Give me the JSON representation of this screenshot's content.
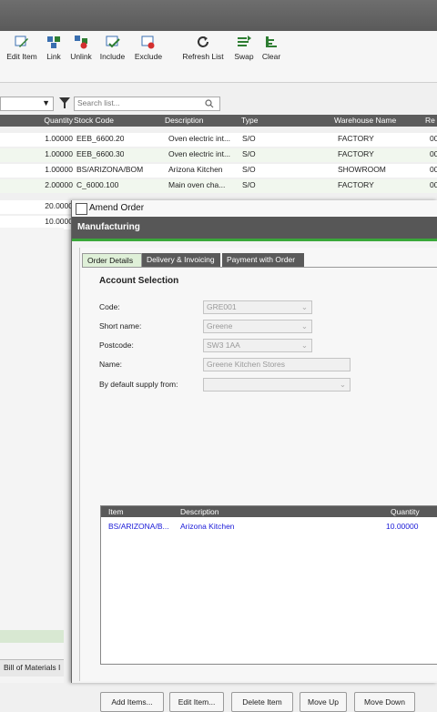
{
  "ribbon": {
    "buttons": [
      {
        "label": "Edit Item",
        "icon": "edit-item-icon"
      },
      {
        "label": "Link",
        "icon": "link-icon"
      },
      {
        "label": "Unlink",
        "icon": "unlink-icon"
      },
      {
        "label": "Include",
        "icon": "include-icon"
      },
      {
        "label": "Exclude",
        "icon": "exclude-icon"
      },
      {
        "label": "Refresh List",
        "icon": "refresh-icon"
      },
      {
        "label": "Swap",
        "icon": "swap-icon"
      },
      {
        "label": "Clear",
        "icon": "clear-icon"
      }
    ]
  },
  "search": {
    "placeholder": "Search list..."
  },
  "grid": {
    "columns": [
      "Quantity",
      "Stock Code",
      "Description",
      "Type",
      "Warehouse Name",
      "Re"
    ],
    "rows": [
      [
        "1.00000",
        "EEB_6600.20",
        "Oven electric int...",
        "S/O",
        "FACTORY",
        "00"
      ],
      [
        "1.00000",
        "EEB_6600.30",
        "Oven electric int...",
        "S/O",
        "FACTORY",
        "00"
      ],
      [
        "1.00000",
        "BS/ARIZONA/BOM",
        "Arizona Kitchen",
        "S/O",
        "SHOWROOM",
        "00"
      ],
      [
        "2.00000",
        "C_6000.100",
        "Main oven cha...",
        "S/O",
        "FACTORY",
        "00"
      ],
      [
        "20.0000",
        "",
        "",
        "",
        "",
        ""
      ],
      [
        "10.0000",
        "",
        "",
        "",
        "",
        ""
      ]
    ]
  },
  "bottom_tab": "Bill of Materials I",
  "dialog": {
    "title": "Amend Order",
    "band": "Manufacturing",
    "tabs": [
      "Order Details",
      "Delivery & Invoicing",
      "Payment with Order"
    ],
    "section_title": "Account Selection",
    "fields": {
      "code": {
        "label": "Code:",
        "value": "GRE001"
      },
      "short_name": {
        "label": "Short name:",
        "value": "Greene"
      },
      "postcode": {
        "label": "Postcode:",
        "value": "SW3 1AA"
      },
      "name": {
        "label": "Name:",
        "value": "Greene Kitchen Stores"
      },
      "supply_from": {
        "label": "By default supply from:",
        "value": ""
      }
    },
    "items_table": {
      "columns": [
        "Item",
        "Description",
        "Quantity"
      ],
      "rows": [
        {
          "item": "BS/ARIZONA/B...",
          "description": "Arizona Kitchen",
          "quantity": "10.00000"
        }
      ]
    },
    "buttons": [
      "Add Items...",
      "Edit Item...",
      "Delete Item",
      "Move Up",
      "Move Down"
    ]
  },
  "colors": {
    "link_blue": "#1a1ad8",
    "accent_green": "#3aa83a",
    "dark_header": "#5a5a5a"
  }
}
